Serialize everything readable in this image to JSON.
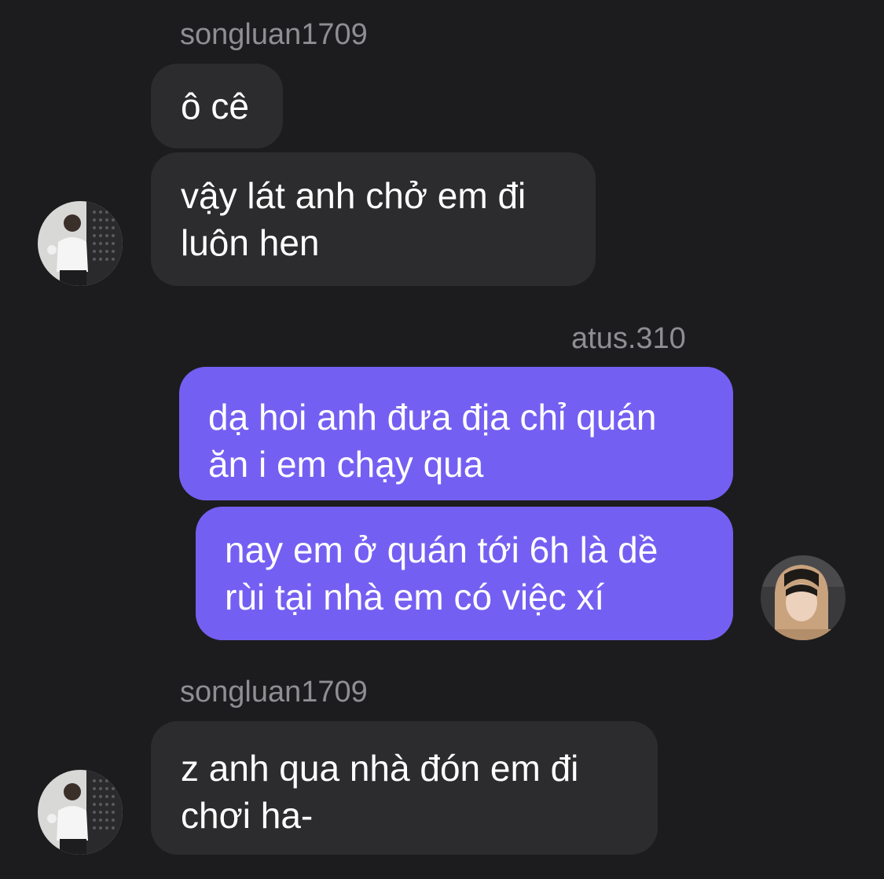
{
  "messages": [
    {
      "sender": "songluan1709"
    },
    {
      "text": "ô cê"
    },
    {
      "text": "vậy lát anh chở em đi\nluôn hen"
    },
    {
      "sender": "atus.310"
    },
    {
      "text": "dạ hoi anh đưa địa chỉ quán\năn i em chạy qua"
    },
    {
      "text": "nay em ở quán tới 6h là dề\nrùi tại nhà em có việc xí"
    },
    {
      "sender": "songluan1709"
    },
    {
      "text": "z anh qua nhà đón em đi\nchơi ha-"
    }
  ],
  "colors": {
    "background": "#1c1c1e",
    "incoming_bubble": "#2c2c2e",
    "outgoing_bubble": "#7360f2",
    "sender_text": "#8e8e93"
  },
  "icons": {
    "incoming_avatar": "profile-photo-songluan1709",
    "outgoing_avatar": "profile-photo-atus310"
  }
}
